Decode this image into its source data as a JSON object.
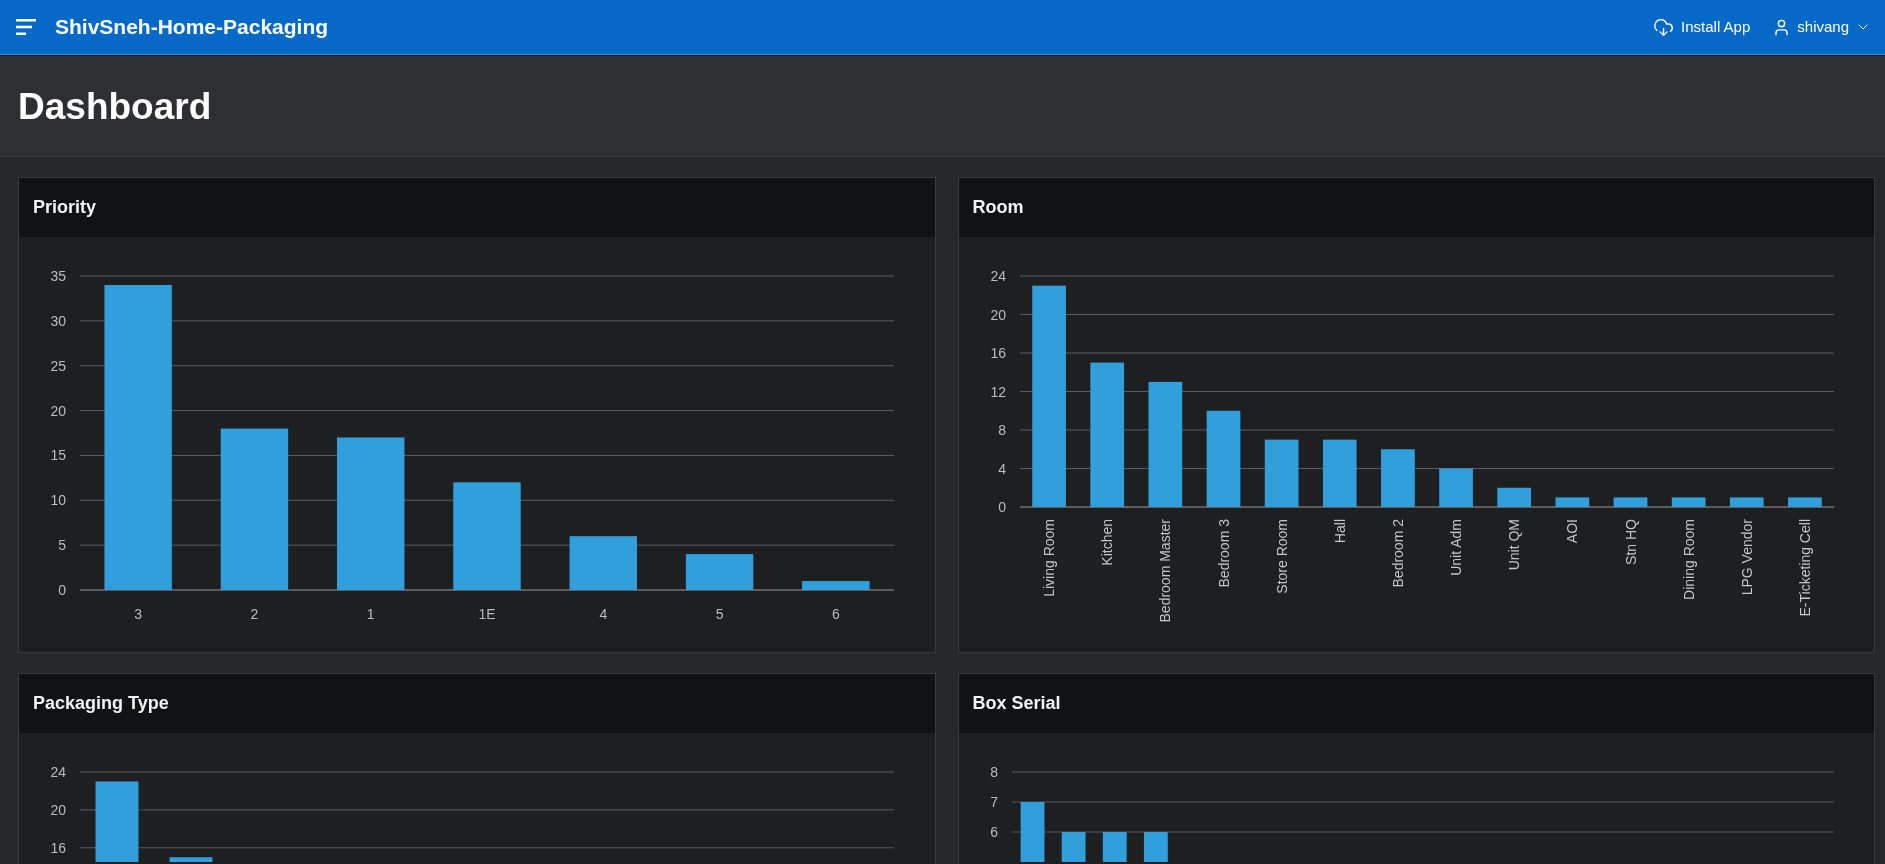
{
  "header": {
    "app_title": "ShivSneh-Home-Packaging",
    "actions": [
      {
        "kind": "install",
        "label": "Install App"
      },
      {
        "kind": "user",
        "label": "shivang"
      }
    ]
  },
  "page": {
    "title": "Dashboard"
  },
  "cards": [
    {
      "title": "Priority",
      "chart_data": {
        "type": "bar",
        "categories": [
          "3",
          "2",
          "1",
          "1E",
          "4",
          "5",
          "6"
        ],
        "values": [
          34,
          18,
          17,
          12,
          6,
          4,
          1
        ],
        "ylim": [
          0,
          35
        ],
        "yticks": [
          0,
          5,
          10,
          15,
          20,
          25,
          30,
          35
        ],
        "grid": true
      }
    },
    {
      "title": "Room",
      "chart_data": {
        "type": "bar",
        "categories": [
          "Living Room",
          "Kitchen",
          "Bedroom Master",
          "Bedroom 3",
          "Store Room",
          "Hall",
          "Bedroom 2",
          "Unit Adm",
          "Unit QM",
          "AOI",
          "Stn HQ",
          "Dining Room",
          "LPG Vendor",
          "E-Ticketing Cell"
        ],
        "values": [
          23,
          15,
          13,
          10,
          7,
          7,
          6,
          4,
          2,
          1,
          1,
          1,
          1,
          1
        ],
        "ylim": [
          0,
          24
        ],
        "yticks": [
          0,
          4,
          8,
          12,
          16,
          20,
          24
        ],
        "grid": true
      }
    },
    {
      "title": "Packaging Type",
      "chart_data": {
        "type": "bar",
        "values": [
          23,
          15,
          null,
          null,
          null,
          null,
          null,
          null,
          null,
          null,
          null
        ],
        "ylim": [
          14.5,
          24
        ],
        "yticks": [
          16,
          20,
          24
        ],
        "grid": true
      }
    },
    {
      "title": "Box Serial",
      "chart_data": {
        "type": "bar",
        "values": [
          7,
          6,
          6,
          6,
          null,
          null,
          null,
          null,
          null,
          null,
          null,
          null,
          null,
          null,
          null,
          null,
          null,
          null,
          null,
          null
        ],
        "ylim": [
          5,
          8
        ],
        "yticks": [
          6,
          7,
          8
        ],
        "grid": true
      }
    }
  ]
}
